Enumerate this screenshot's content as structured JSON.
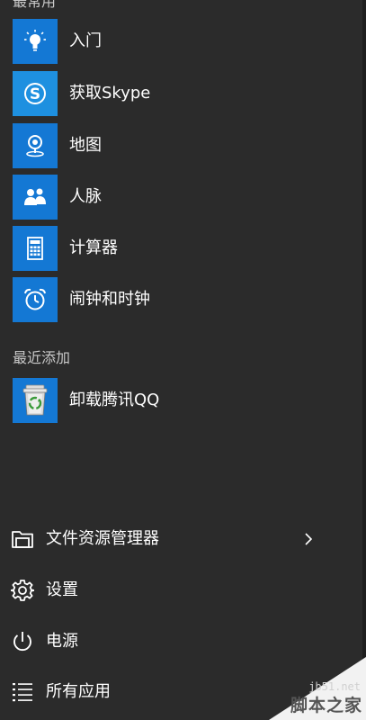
{
  "sections": {
    "most_used": "最常用",
    "recently_added": "最近添加"
  },
  "most_used_apps": [
    {
      "label": "入门",
      "icon": "lightbulb-icon"
    },
    {
      "label": "获取Skype",
      "icon": "skype-icon"
    },
    {
      "label": "地图",
      "icon": "map-pin-icon"
    },
    {
      "label": "人脉",
      "icon": "people-icon"
    },
    {
      "label": "计算器",
      "icon": "calculator-icon"
    },
    {
      "label": "闹钟和时钟",
      "icon": "alarm-clock-icon"
    }
  ],
  "recent_apps": [
    {
      "label": "卸载腾讯QQ",
      "icon": "recycle-bin-icon"
    }
  ],
  "system_items": [
    {
      "label": "文件资源管理器",
      "icon": "folder-icon",
      "has_arrow": true
    },
    {
      "label": "设置",
      "icon": "gear-icon"
    },
    {
      "label": "电源",
      "icon": "power-icon"
    },
    {
      "label": "所有应用",
      "icon": "list-icon"
    }
  ],
  "watermark": {
    "url": "jb51.net",
    "brand": "脚本之家"
  },
  "colors": {
    "background": "#2b2b2b",
    "tile": "#1478d4",
    "text": "#ffffff"
  }
}
